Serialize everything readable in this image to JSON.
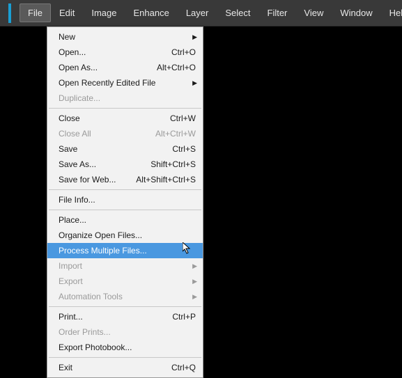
{
  "menubar": {
    "items": [
      "File",
      "Edit",
      "Image",
      "Enhance",
      "Layer",
      "Select",
      "Filter",
      "View",
      "Window",
      "Help"
    ]
  },
  "dropdown": {
    "groups": [
      [
        {
          "label": "New",
          "submenu": true
        },
        {
          "label": "Open...",
          "shortcut": "Ctrl+O"
        },
        {
          "label": "Open As...",
          "shortcut": "Alt+Ctrl+O"
        },
        {
          "label": "Open Recently Edited File",
          "submenu": true
        },
        {
          "label": "Duplicate...",
          "disabled": true
        }
      ],
      [
        {
          "label": "Close",
          "shortcut": "Ctrl+W"
        },
        {
          "label": "Close All",
          "shortcut": "Alt+Ctrl+W",
          "disabled": true
        },
        {
          "label": "Save",
          "shortcut": "Ctrl+S"
        },
        {
          "label": "Save As...",
          "shortcut": "Shift+Ctrl+S"
        },
        {
          "label": "Save for Web...",
          "shortcut": "Alt+Shift+Ctrl+S"
        }
      ],
      [
        {
          "label": "File Info..."
        }
      ],
      [
        {
          "label": "Place..."
        },
        {
          "label": "Organize Open Files..."
        },
        {
          "label": "Process Multiple Files...",
          "highlighted": true
        },
        {
          "label": "Import",
          "submenu": true,
          "disabled": true
        },
        {
          "label": "Export",
          "submenu": true,
          "disabled": true
        },
        {
          "label": "Automation Tools",
          "submenu": true,
          "disabled": true
        }
      ],
      [
        {
          "label": "Print...",
          "shortcut": "Ctrl+P"
        },
        {
          "label": "Order Prints...",
          "disabled": true
        },
        {
          "label": "Export Photobook..."
        }
      ],
      [
        {
          "label": "Exit",
          "shortcut": "Ctrl+Q"
        }
      ]
    ]
  }
}
